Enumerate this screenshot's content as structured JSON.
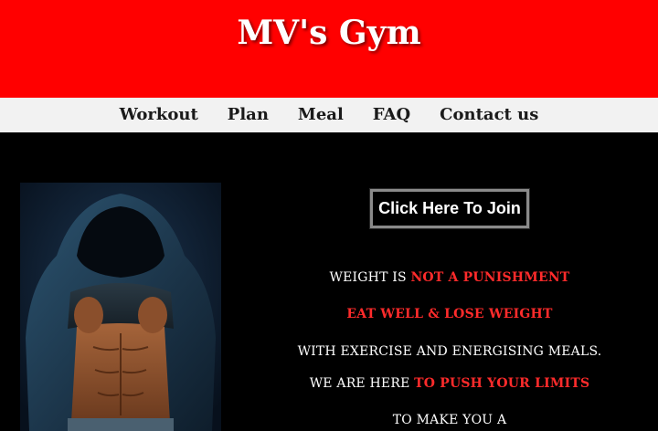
{
  "header": {
    "title": "MV's Gym"
  },
  "nav": {
    "items": [
      "Workout",
      "Plan",
      "Meal",
      "FAQ",
      "Contact us"
    ]
  },
  "hero": {
    "image_icon": "muscular-man-hoodie-photo"
  },
  "cta": {
    "join_label": "Click Here To Join"
  },
  "tagline": {
    "line1_a": "WEIGHT IS ",
    "line1_b": "NOT A PUNISHMENT",
    "line2": "EAT WELL & LOSE WEIGHT",
    "line3": "WITH EXERCISE AND ENERGISING MEALS.",
    "line4_a": "WE ARE HERE ",
    "line4_b": "TO PUSH YOUR LIMITS",
    "line5": "TO MAKE YOU A"
  },
  "colors": {
    "brand_red": "#ff0000",
    "highlight_red": "#ff2b2b",
    "nav_bg": "#f2f2f2",
    "background": "#000000"
  }
}
